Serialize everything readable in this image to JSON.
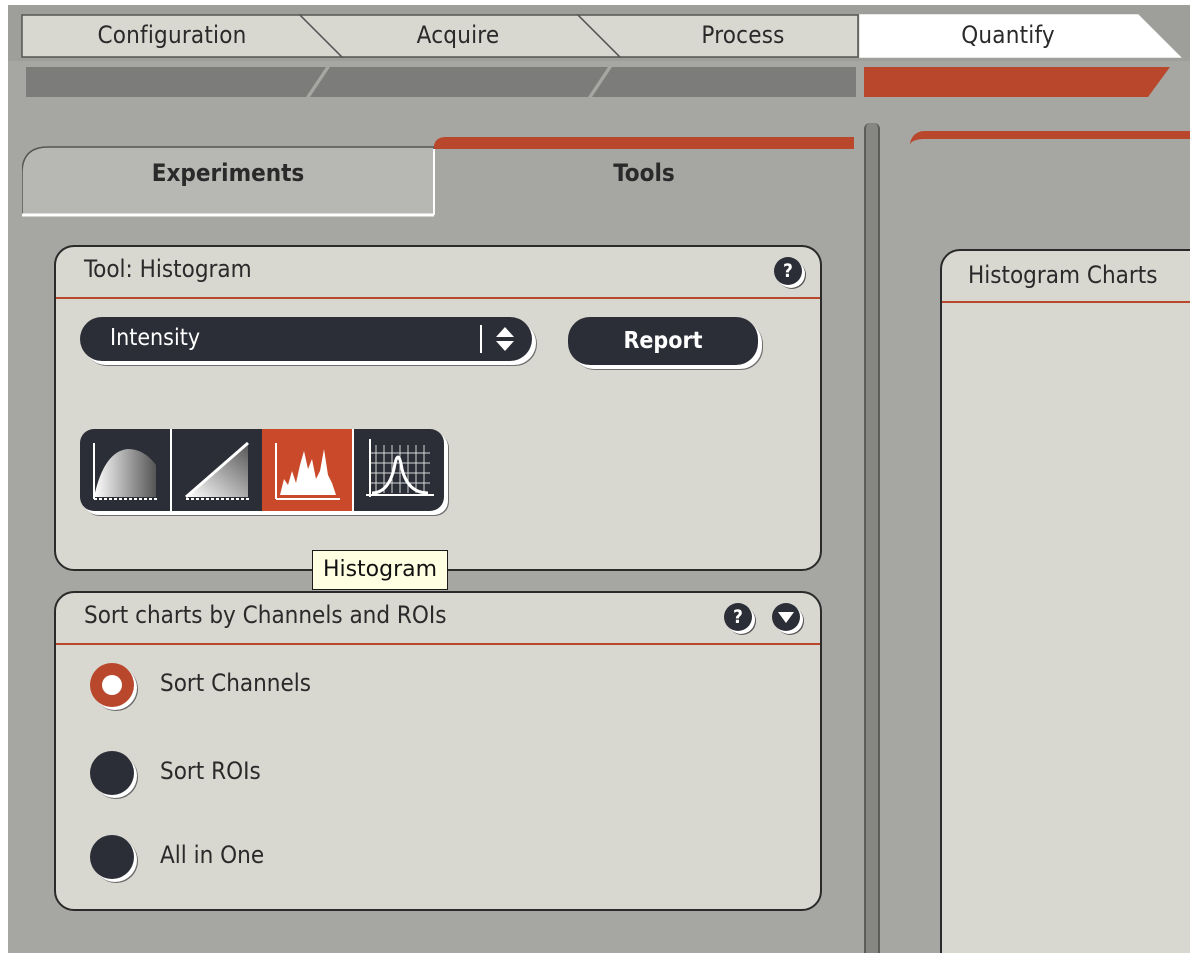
{
  "workflow_tabs": [
    {
      "label": "Configuration",
      "active": false
    },
    {
      "label": "Acquire",
      "active": false
    },
    {
      "label": "Process",
      "active": false
    },
    {
      "label": "Quantify",
      "active": true
    }
  ],
  "subtabs": [
    {
      "label": "Experiments",
      "active": false
    },
    {
      "label": "Tools",
      "active": true
    }
  ],
  "tool_panel": {
    "title": "Tool: Histogram",
    "help_icon": "question-mark",
    "measure_select": {
      "value": "Intensity"
    },
    "report_button": "Report",
    "view_modes": [
      {
        "icon": "cumulative-curve-icon",
        "selected": false
      },
      {
        "icon": "linear-ramp-icon",
        "selected": false
      },
      {
        "icon": "histogram-peaks-icon",
        "selected": true
      },
      {
        "icon": "gaussian-fit-icon",
        "selected": false
      }
    ],
    "tooltip": "Histogram"
  },
  "sort_panel": {
    "title": "Sort charts by Channels and ROIs",
    "options": [
      {
        "label": "Sort Channels",
        "selected": true
      },
      {
        "label": "Sort ROIs",
        "selected": false
      },
      {
        "label": "All in One",
        "selected": false
      }
    ]
  },
  "right_panel": {
    "title": "Histogram Charts"
  },
  "colors": {
    "accent": "#b8472c",
    "panel_bg": "#d8d7d0",
    "app_bg": "#a6a6a3",
    "control_dark": "#2b2e36",
    "tooltip_bg": "#ffffe1"
  }
}
